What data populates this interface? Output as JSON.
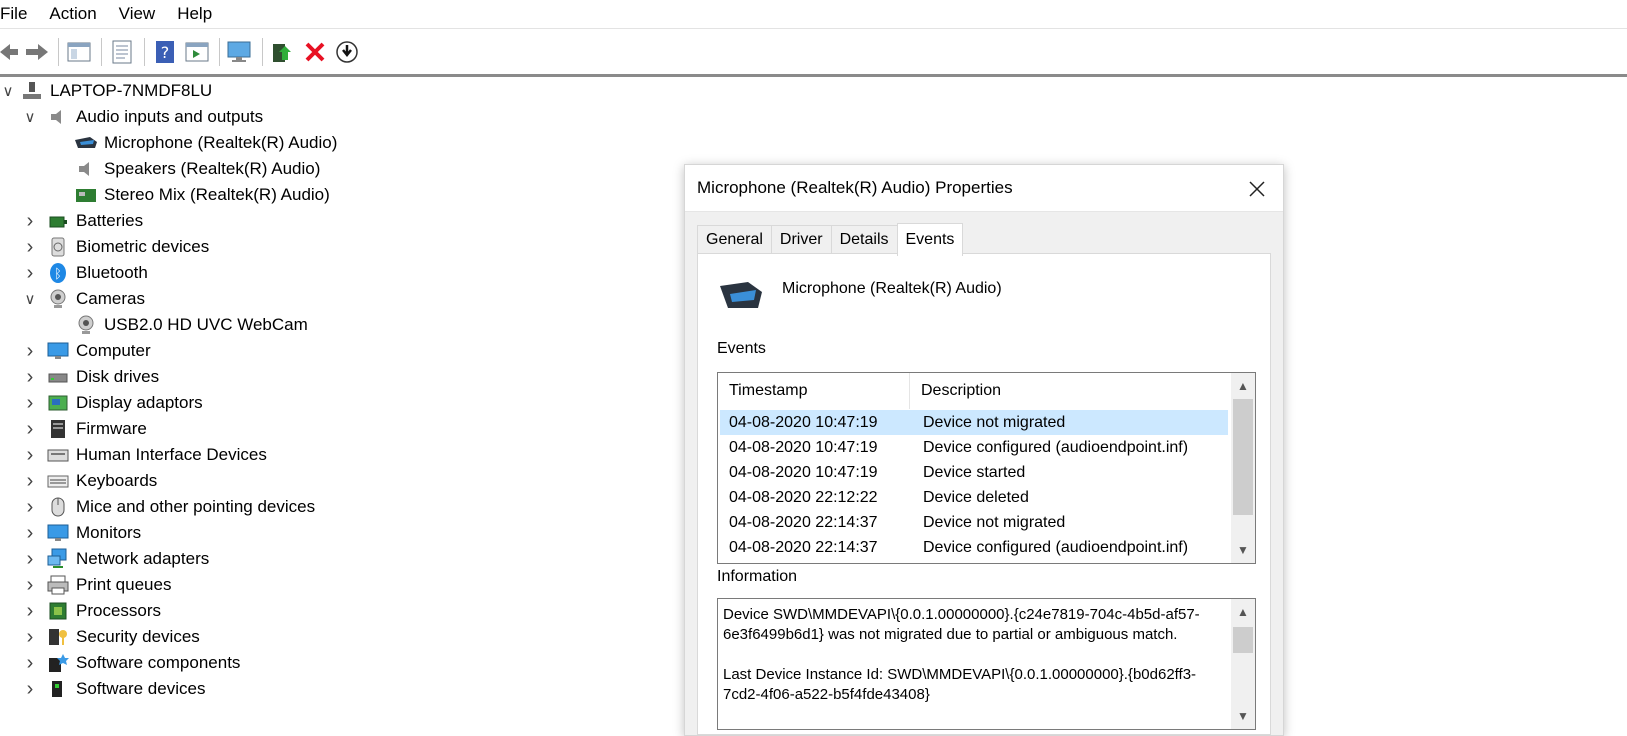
{
  "menu": [
    "File",
    "Action",
    "View",
    "Help"
  ],
  "tree": {
    "root": "LAPTOP-7NMDF8LU",
    "items": [
      {
        "label": "Audio inputs and outputs",
        "expanded": true,
        "children": [
          "Microphone (Realtek(R) Audio)",
          "Speakers (Realtek(R) Audio)",
          "Stereo Mix (Realtek(R) Audio)"
        ]
      },
      {
        "label": "Batteries"
      },
      {
        "label": "Biometric devices"
      },
      {
        "label": "Bluetooth"
      },
      {
        "label": "Cameras",
        "expanded": true,
        "children": [
          "USB2.0 HD UVC WebCam"
        ]
      },
      {
        "label": "Computer"
      },
      {
        "label": "Disk drives"
      },
      {
        "label": "Display adaptors"
      },
      {
        "label": "Firmware"
      },
      {
        "label": "Human Interface Devices"
      },
      {
        "label": "Keyboards"
      },
      {
        "label": "Mice and other pointing devices"
      },
      {
        "label": "Monitors"
      },
      {
        "label": "Network adapters"
      },
      {
        "label": "Print queues"
      },
      {
        "label": "Processors"
      },
      {
        "label": "Security devices"
      },
      {
        "label": "Software components"
      },
      {
        "label": "Software devices"
      }
    ]
  },
  "dialog": {
    "title": "Microphone (Realtek(R) Audio) Properties",
    "tabs": [
      "General",
      "Driver",
      "Details",
      "Events"
    ],
    "active_tab": "Events",
    "device_name": "Microphone (Realtek(R) Audio)",
    "events_label": "Events",
    "columns": [
      "Timestamp",
      "Description"
    ],
    "events": [
      {
        "timestamp": "04-08-2020 10:47:19",
        "description": "Device not migrated"
      },
      {
        "timestamp": "04-08-2020 10:47:19",
        "description": "Device configured (audioendpoint.inf)"
      },
      {
        "timestamp": "04-08-2020 10:47:19",
        "description": "Device started"
      },
      {
        "timestamp": "04-08-2020 22:12:22",
        "description": "Device deleted"
      },
      {
        "timestamp": "04-08-2020 22:14:37",
        "description": "Device not migrated"
      },
      {
        "timestamp": "04-08-2020 22:14:37",
        "description": "Device configured (audioendpoint.inf)"
      }
    ],
    "information_label": "Information",
    "information_text": "Device SWD\\MMDEVAPI\\{0.0.1.00000000}.{c24e7819-704c-4b5d-af57-6e3f6499b6d1} was not migrated due to partial or ambiguous match.\n\nLast Device Instance Id: SWD\\MMDEVAPI\\{0.0.1.00000000}.{b0d62ff3-7cd2-4f06-a522-b5f4fde43408}"
  },
  "colors": {
    "selection": "#cce8ff",
    "close_x": "#e81123"
  }
}
